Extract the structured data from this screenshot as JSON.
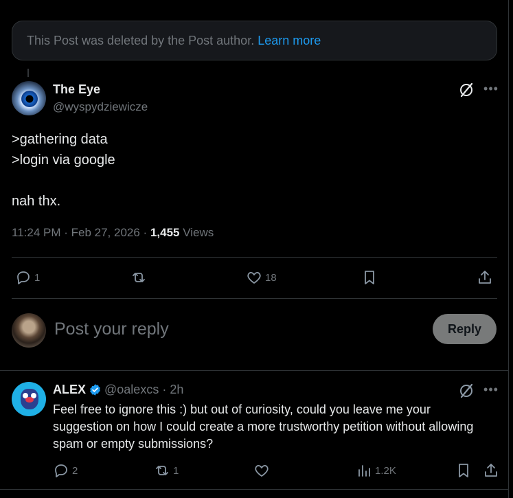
{
  "deleted_notice": {
    "text": "This Post was deleted by the Post author.",
    "link": "Learn more"
  },
  "post": {
    "author_name": "The Eye",
    "author_handle": "@wyspydziewicze",
    "text": ">gathering data\n>login via google\n\nnah thx.",
    "time": "11:24 PM",
    "date": "Feb 27, 2026",
    "views_count": "1,455",
    "views_label": "Views",
    "replies": "1",
    "reposts": "",
    "likes": "18"
  },
  "composer": {
    "placeholder": "Post your reply",
    "button_label": "Reply"
  },
  "reply": {
    "author_name": "ALEX",
    "author_handle": "@oalexcs",
    "time": "2h",
    "text": "Feel free to ignore this :) but out of curiosity, could you leave me your suggestion on how I could create a more trustworthy petition without allowing spam or empty submissions?",
    "replies": "2",
    "reposts": "1",
    "likes": "",
    "views": "1.2K"
  },
  "colors": {
    "background": "#000000",
    "accent": "#1d9bf0",
    "muted": "#71767b",
    "text": "#e7e9ea"
  }
}
